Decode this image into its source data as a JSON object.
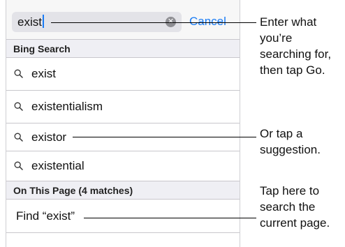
{
  "search": {
    "query": "exist",
    "clear_icon": "x-circle-icon",
    "cancel_label": "Cancel"
  },
  "sections": {
    "bing_header": "Bing Search",
    "page_header": "On This Page (4 matches)"
  },
  "suggestions": [
    {
      "label": "exist",
      "icon": "magnifier-icon"
    },
    {
      "label": "existentialism",
      "icon": "magnifier-icon"
    },
    {
      "label": "existor",
      "icon": "magnifier-icon"
    },
    {
      "label": "existential",
      "icon": "magnifier-icon"
    }
  ],
  "find_on_page": {
    "label": "Find “exist”"
  },
  "callouts": {
    "search_field": "Enter what you’re searching for, then tap Go.",
    "suggestion": "Or tap a suggestion.",
    "find": "Tap here to search the current page."
  },
  "colors": {
    "accent": "#1a7cf5",
    "section_bg": "#efeff4",
    "field_bg": "#e3e3e8"
  }
}
